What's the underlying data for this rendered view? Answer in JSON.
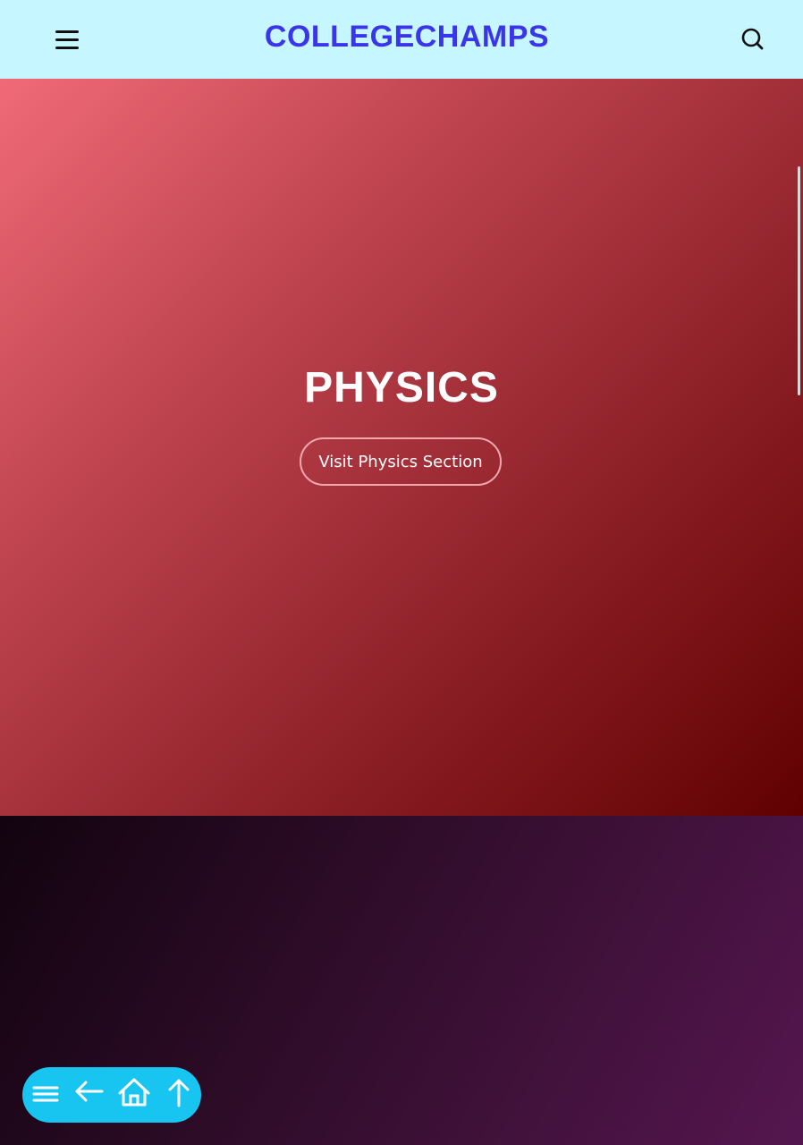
{
  "header": {
    "brand": "COLLEGECHAMPS",
    "menu_icon": "hamburger-menu-icon",
    "search_icon": "search-icon",
    "background": "#c6f6ff",
    "brand_color": "#3b35ea"
  },
  "hero": {
    "title": "PHYSICS",
    "button_label": "Visit Physics Section",
    "gradient_start": "#f06a77",
    "gradient_end": "#600000"
  },
  "floating_nav": {
    "background": "#18c4f0",
    "items": [
      {
        "icon": "hamburger-menu-icon"
      },
      {
        "icon": "back-arrow-icon"
      },
      {
        "icon": "home-icon"
      },
      {
        "icon": "up-arrow-icon"
      }
    ]
  }
}
